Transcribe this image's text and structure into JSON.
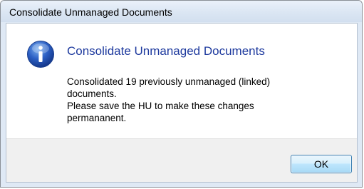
{
  "window": {
    "title": "Consolidate Unmanaged Documents"
  },
  "dialog": {
    "icon": "info-icon",
    "heading": "Consolidate Unmanaged Documents",
    "message_lines": [
      "Consolidated 19 previously unmanaged (linked)",
      "documents.",
      "Please save the HU to make these changes",
      "permananent."
    ],
    "ok_label": "OK"
  },
  "colors": {
    "heading": "#1e3a9e",
    "icon_blue": "#2b5fc4",
    "footer_bg": "#f0f0f0",
    "button_border": "#3c7fb1"
  }
}
